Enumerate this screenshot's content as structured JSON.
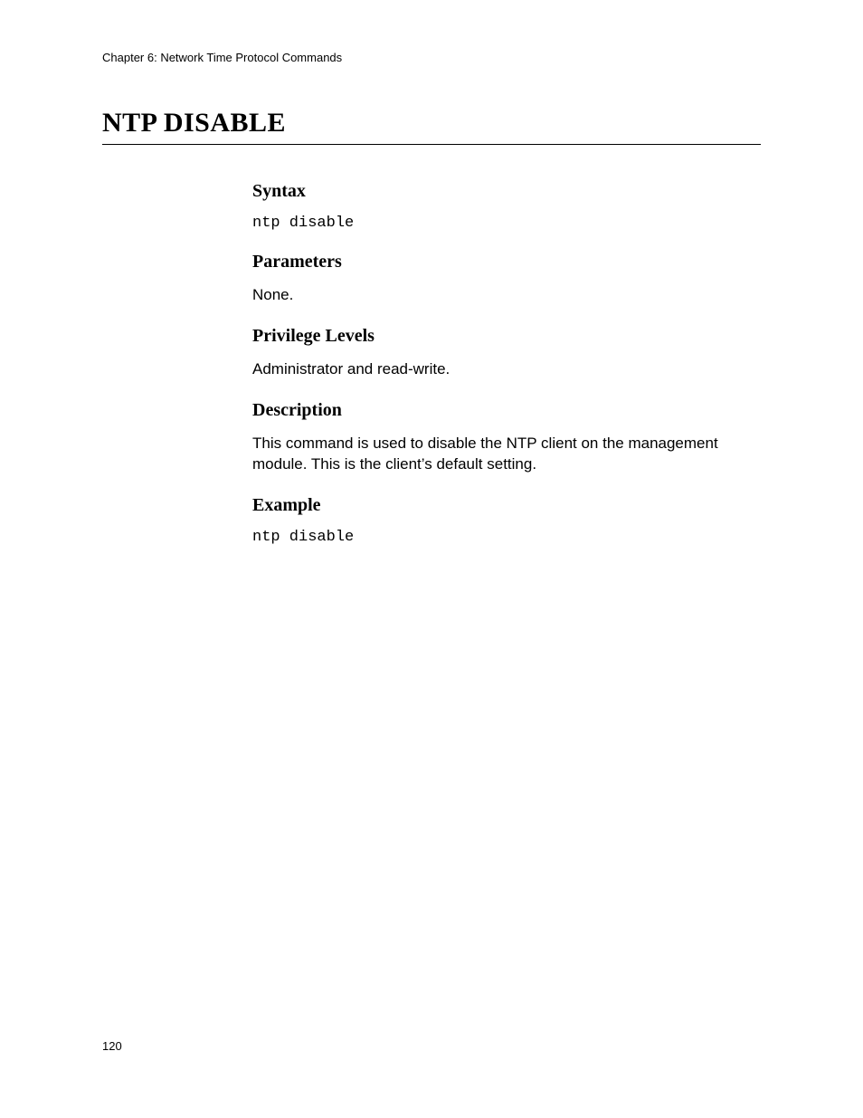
{
  "header": {
    "text": "Chapter 6: Network Time Protocol Commands"
  },
  "title": "NTP DISABLE",
  "sections": {
    "syntax": {
      "heading": "Syntax",
      "code": "ntp disable"
    },
    "parameters": {
      "heading": "Parameters",
      "text": "None."
    },
    "privilege": {
      "heading": "Privilege Levels",
      "text": "Administrator and read-write."
    },
    "description": {
      "heading": "Description",
      "text": "This command is used to disable the NTP client on the management module. This is the client’s default setting."
    },
    "example": {
      "heading": "Example",
      "code": "ntp disable"
    }
  },
  "page_number": "120"
}
